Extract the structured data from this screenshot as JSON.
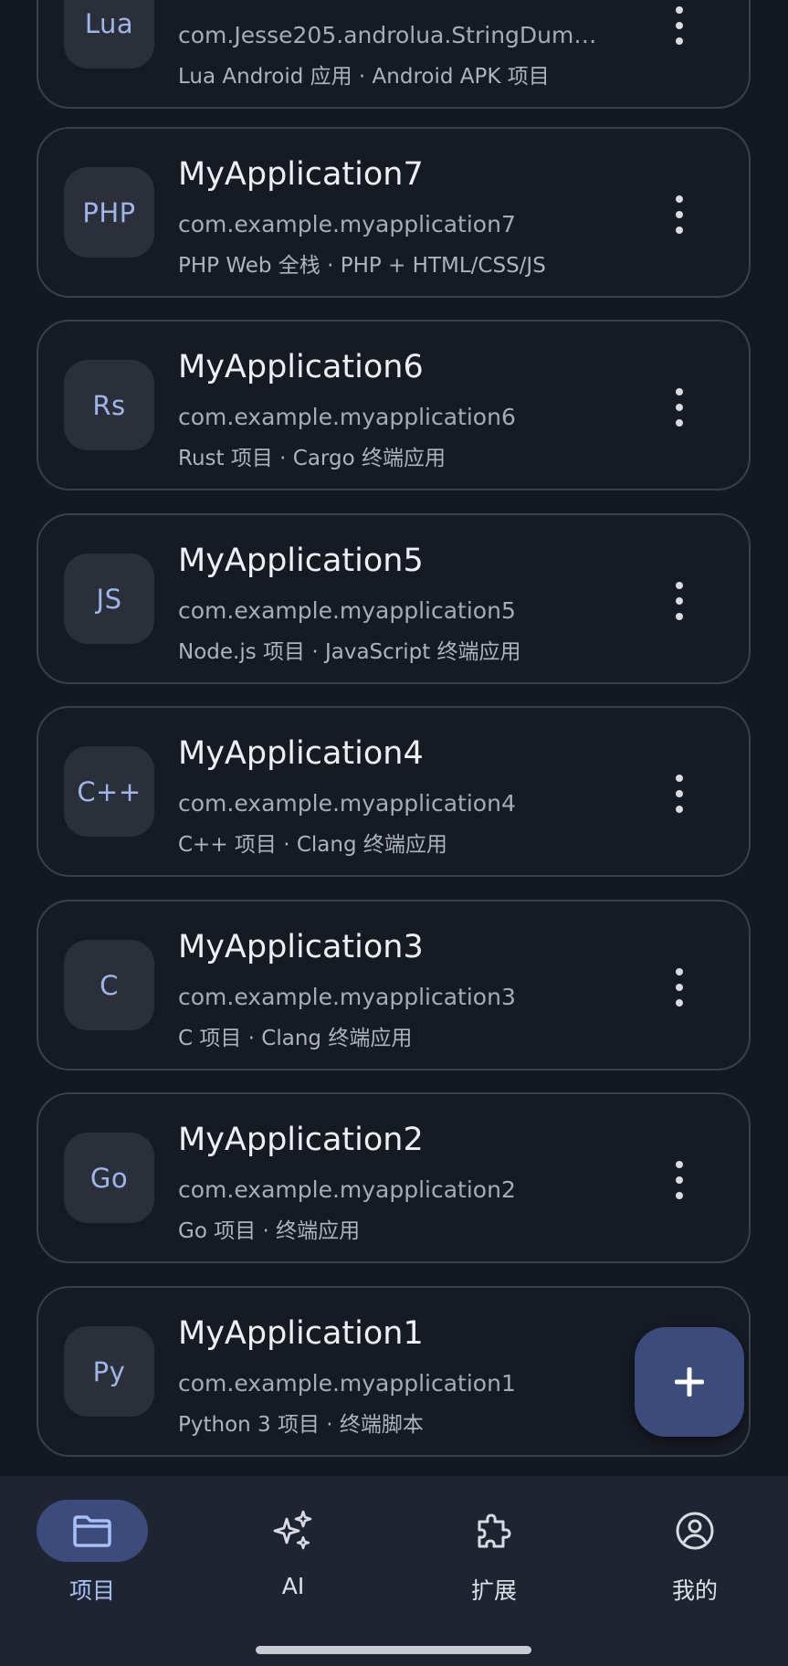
{
  "projects": [
    {
      "badge": "Lua",
      "name": "",
      "package": "com.Jesse205.androlua.StringDum…",
      "tags": "Lua Android 应用 · Android APK 项目"
    },
    {
      "badge": "PHP",
      "name": "MyApplication7",
      "package": "com.example.myapplication7",
      "tags": "PHP Web 全栈 · PHP + HTML/CSS/JS"
    },
    {
      "badge": "Rs",
      "name": "MyApplication6",
      "package": "com.example.myapplication6",
      "tags": "Rust 项目 · Cargo 终端应用"
    },
    {
      "badge": "JS",
      "name": "MyApplication5",
      "package": "com.example.myapplication5",
      "tags": "Node.js 项目 · JavaScript 终端应用"
    },
    {
      "badge": "C++",
      "name": "MyApplication4",
      "package": "com.example.myapplication4",
      "tags": "C++ 项目 · Clang 终端应用"
    },
    {
      "badge": "C",
      "name": "MyApplication3",
      "package": "com.example.myapplication3",
      "tags": "C 项目 · Clang 终端应用"
    },
    {
      "badge": "Go",
      "name": "MyApplication2",
      "package": "com.example.myapplication2",
      "tags": "Go 项目 · 终端应用"
    },
    {
      "badge": "Py",
      "name": "MyApplication1",
      "package": "com.example.myapplication1",
      "tags": "Python 3 项目 · 终端脚本"
    }
  ],
  "fab": {
    "icon": "plus-icon"
  },
  "nav": [
    {
      "label": "项目",
      "icon": "folder-icon",
      "active": true
    },
    {
      "label": "AI",
      "icon": "sparkles-icon",
      "active": false
    },
    {
      "label": "扩展",
      "icon": "puzzle-icon",
      "active": false
    },
    {
      "label": "我的",
      "icon": "account-circle-icon",
      "active": false
    }
  ],
  "colors": {
    "background": "#141820",
    "card_border": "#3a3f48",
    "badge_bg": "#2b2f39",
    "badge_text": "#9fb6ec",
    "accent": "#3a4b7c",
    "nav_bg": "#1f2431",
    "active_label": "#a8c0f5"
  }
}
